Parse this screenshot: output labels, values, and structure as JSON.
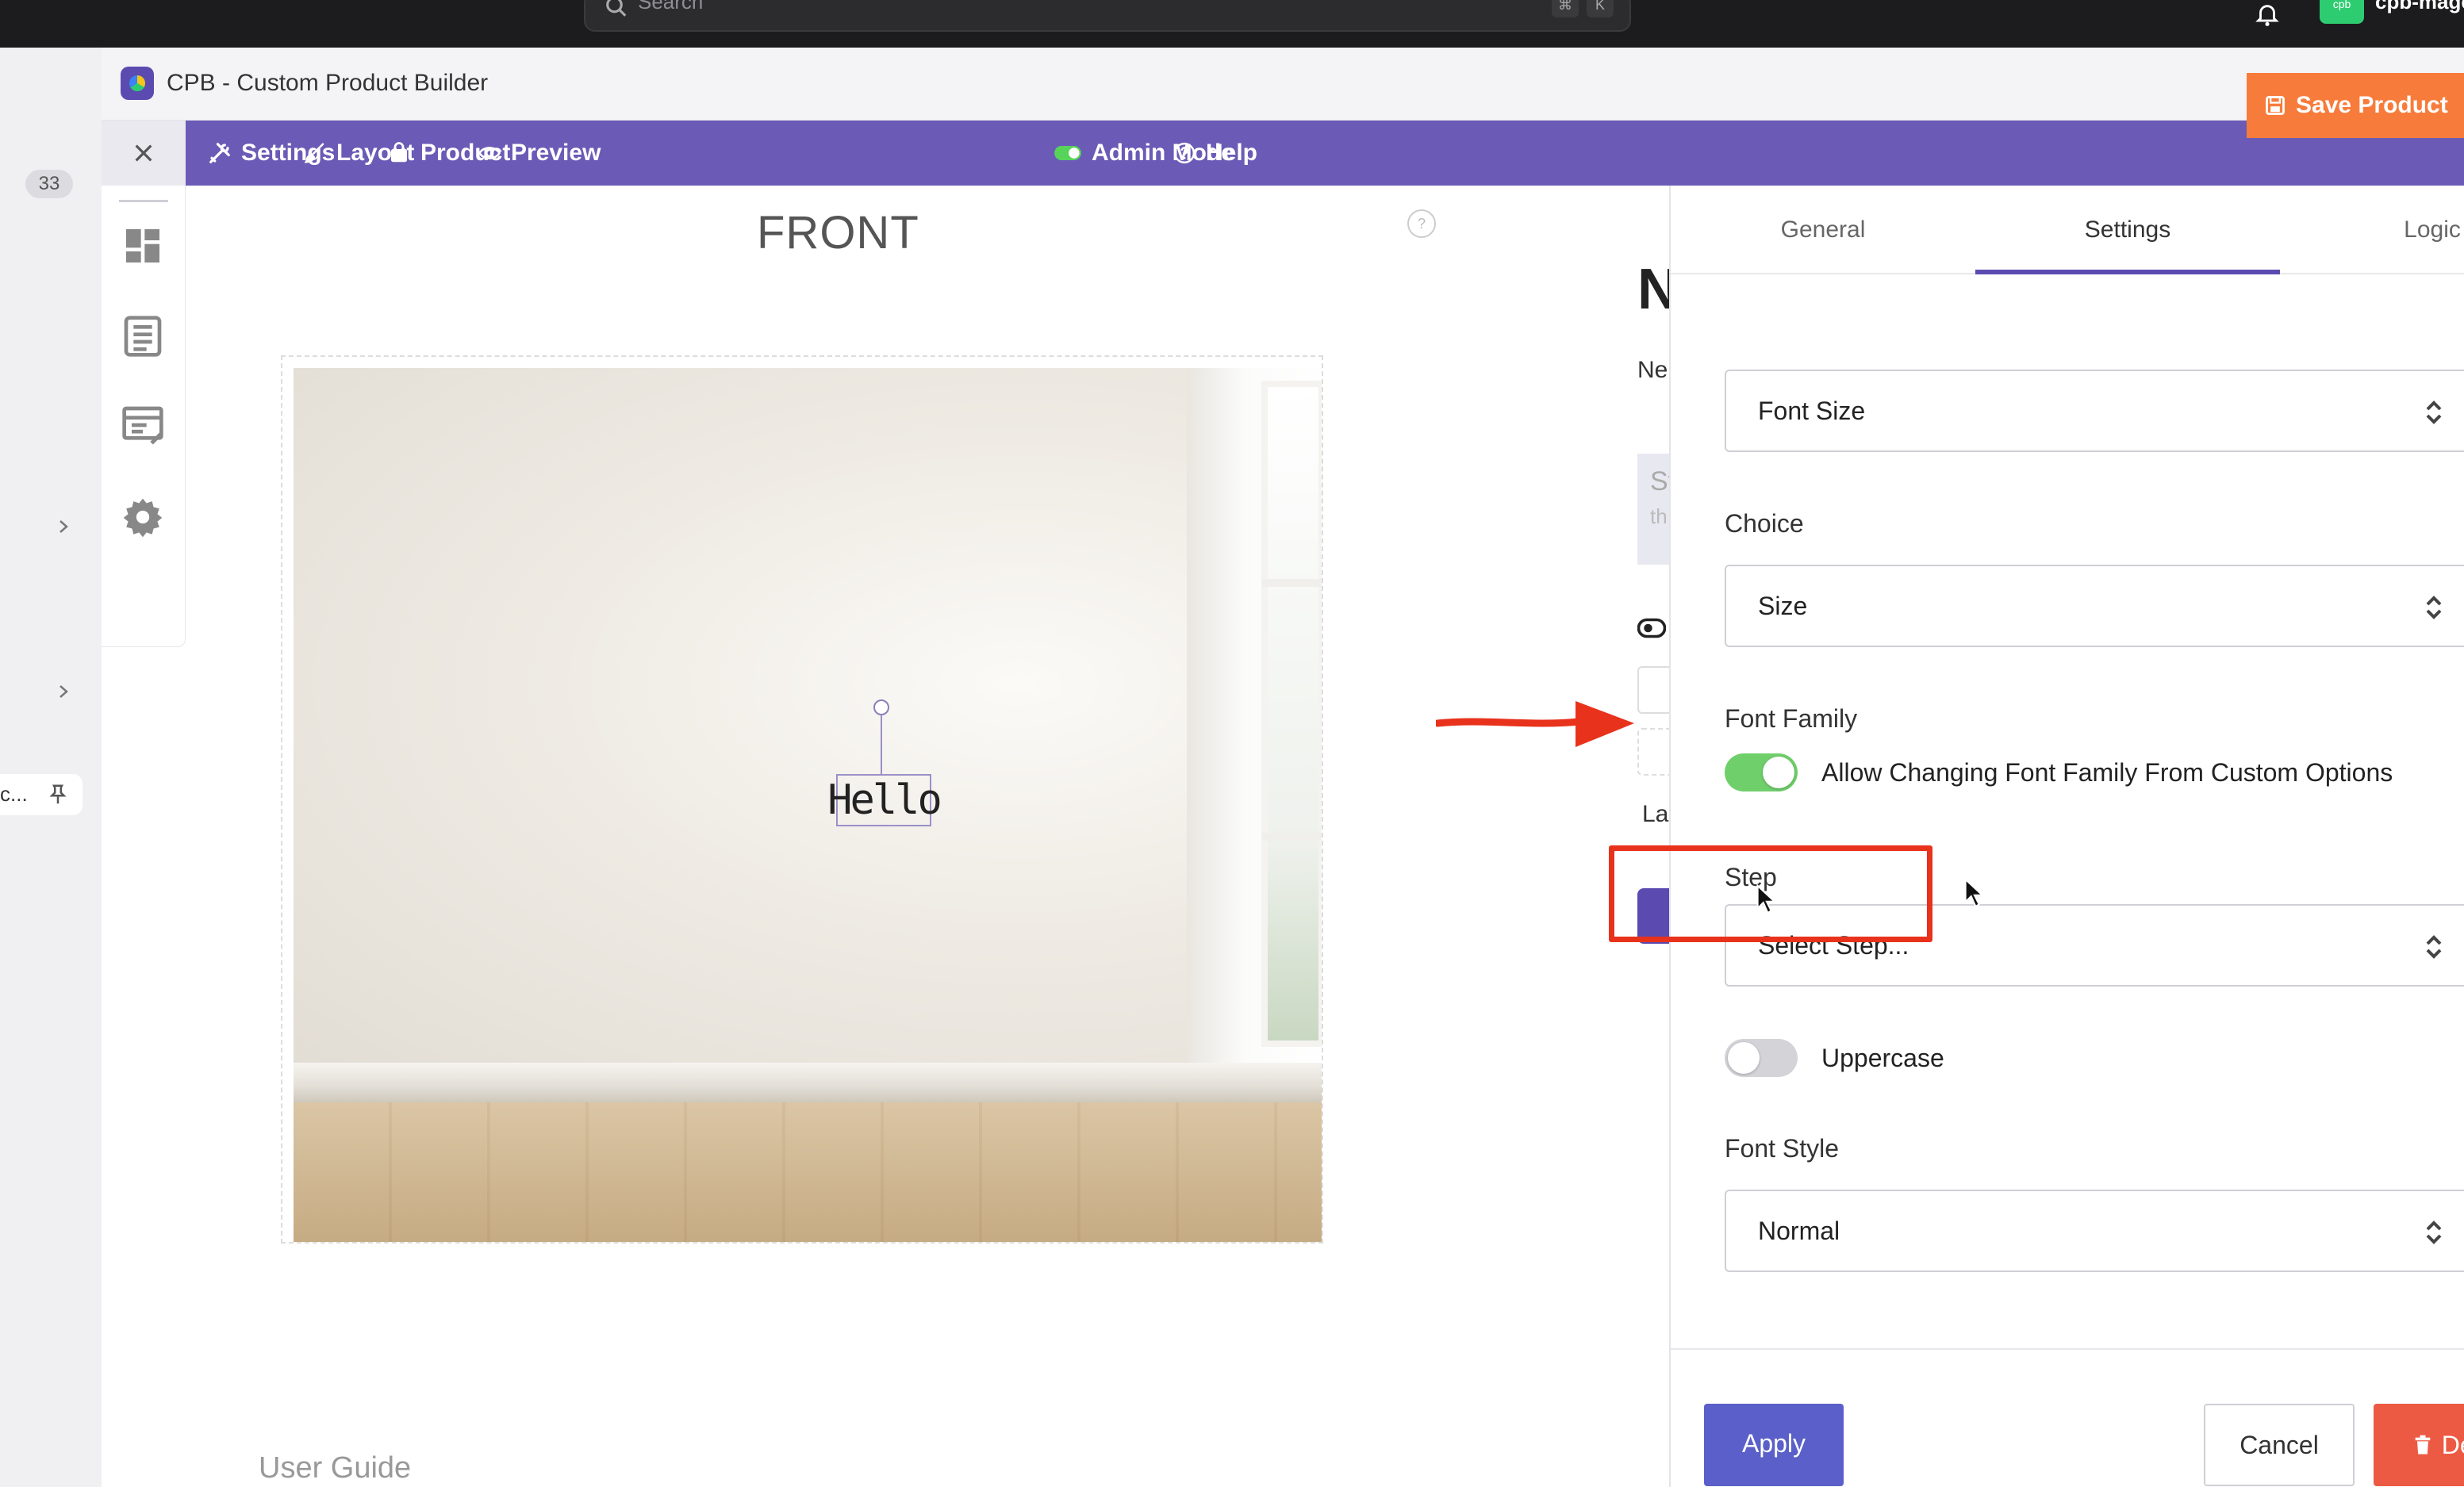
{
  "os_bar": {
    "search_placeholder": "Search",
    "shortcut_keys": [
      "⌘",
      "K"
    ],
    "app_badge": "cpb",
    "app_name": "cpb-mage"
  },
  "left_strip": {
    "badge_count": "33",
    "pinned_item_label": "c..."
  },
  "window": {
    "title": "CPB - Custom Product Builder"
  },
  "toolbar": {
    "settings": "Settings",
    "layout": "Layout",
    "product": "Product",
    "preview": "Preview",
    "admin_mode": "Admin Mode",
    "help": "Help",
    "save_product": "Save Product",
    "accent_color": "#6b5bb6",
    "save_color": "#f77c3b"
  },
  "canvas": {
    "side_label": "FRONT",
    "help_icon": "?",
    "text_layer": "Hello",
    "user_guide": "User Guide"
  },
  "middle_column": {
    "heading_fragment": "N",
    "subtitle_fragment": "Ne",
    "box_line1": "St",
    "box_line2": "th",
    "label_fragment": "La"
  },
  "panel": {
    "tabs": [
      {
        "label": "General",
        "active": false
      },
      {
        "label": "Settings",
        "active": true
      },
      {
        "label": "Logic",
        "active": false
      }
    ],
    "font_size_select": {
      "value": "Font Size"
    },
    "choice": {
      "label": "Choice",
      "value": "Size"
    },
    "font_family": {
      "label": "Font Family",
      "toggle_label": "Allow Changing Font Family From Custom Options",
      "toggle_on": true
    },
    "step": {
      "label": "Step",
      "value": "Select Step..."
    },
    "uppercase": {
      "label": "Uppercase",
      "toggle_on": false
    },
    "font_style": {
      "label": "Font Style",
      "value": "Normal"
    },
    "buttons": {
      "apply": "Apply",
      "cancel": "Cancel",
      "delete": "Delete"
    }
  },
  "annotation_color": "#e8321c"
}
